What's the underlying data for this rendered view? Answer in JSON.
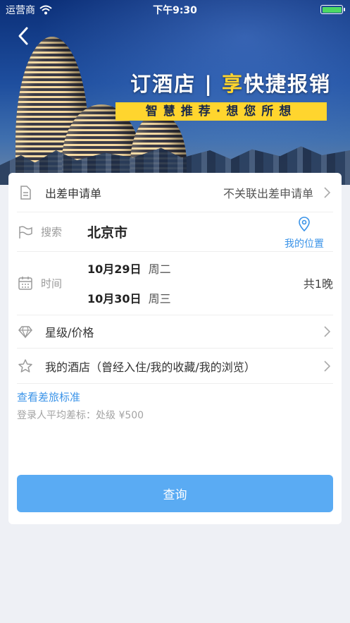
{
  "status_bar": {
    "carrier": "运营商",
    "time": "下午9:30"
  },
  "banner": {
    "title_pre": "订酒店 | ",
    "title_highlight": "享",
    "title_post": "快捷报销",
    "subtitle": "智慧推荐·想您所想"
  },
  "form": {
    "apply_row": {
      "label": "出差申请单",
      "value": "不关联出差申请单"
    },
    "search_row": {
      "label": "搜索",
      "city": "北京市",
      "location_label": "我的位置"
    },
    "date_row": {
      "label": "时间",
      "checkin_date": "10月29日",
      "checkin_weekday": "周二",
      "checkout_date": "10月30日",
      "checkout_weekday": "周三",
      "nights": "共1晚"
    },
    "star_row": {
      "label": "星级/价格"
    },
    "hotel_row": {
      "label": "我的酒店（曾经入住/我的收藏/我的浏览）"
    },
    "standard_link": "查看差旅标准",
    "standard_note": "登录人平均差标：处级 ¥500",
    "query_button": "查询"
  },
  "colors": {
    "accent_blue": "#3a93e8",
    "button_blue": "#5aabf3",
    "banner_yellow": "#ffd52e",
    "battery_green": "#4cd964"
  }
}
